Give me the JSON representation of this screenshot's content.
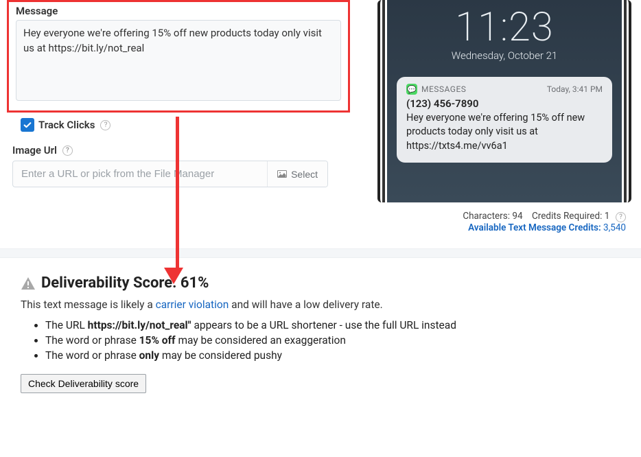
{
  "message": {
    "label": "Message",
    "value": "Hey everyone we're offering 15% off new products today only visit us at https://bit.ly/not_real"
  },
  "track_clicks": {
    "label": "Track Clicks",
    "checked": true
  },
  "image_url": {
    "label": "Image Url",
    "placeholder": "Enter a URL or pick from the File Manager",
    "select_label": "Select"
  },
  "phone": {
    "time": "11:23",
    "date": "Wednesday, October 21",
    "notification": {
      "app": "MESSAGES",
      "when": "Today, 3:41 PM",
      "from": "(123) 456-7890",
      "body": "Hey everyone we're offering 15% off new products today only visit us at https://txts4.me/vv6a1"
    }
  },
  "credits": {
    "chars_label": "Characters:",
    "chars_value": "94",
    "req_label": "Credits Required:",
    "req_value": "1",
    "avail_label": "Available Text Message Credits:",
    "avail_value": "3,540"
  },
  "score": {
    "title_prefix": "Deliverability Score:",
    "percent": "61%",
    "sub_before": "This text message is likely a ",
    "sub_link": "carrier violation",
    "sub_after": " and will have a low delivery rate.",
    "bullets": [
      {
        "pre": "The URL ",
        "bold": "https://bit.ly/not_real\"",
        "post": " appears to be a URL shortener - use the full URL instead"
      },
      {
        "pre": "The word or phrase ",
        "bold": "15% off",
        "post": " may be considered an exaggeration"
      },
      {
        "pre": "The word or phrase ",
        "bold": "only",
        "post": " may be considered pushy"
      }
    ],
    "check_button": "Check Deliverability score"
  }
}
